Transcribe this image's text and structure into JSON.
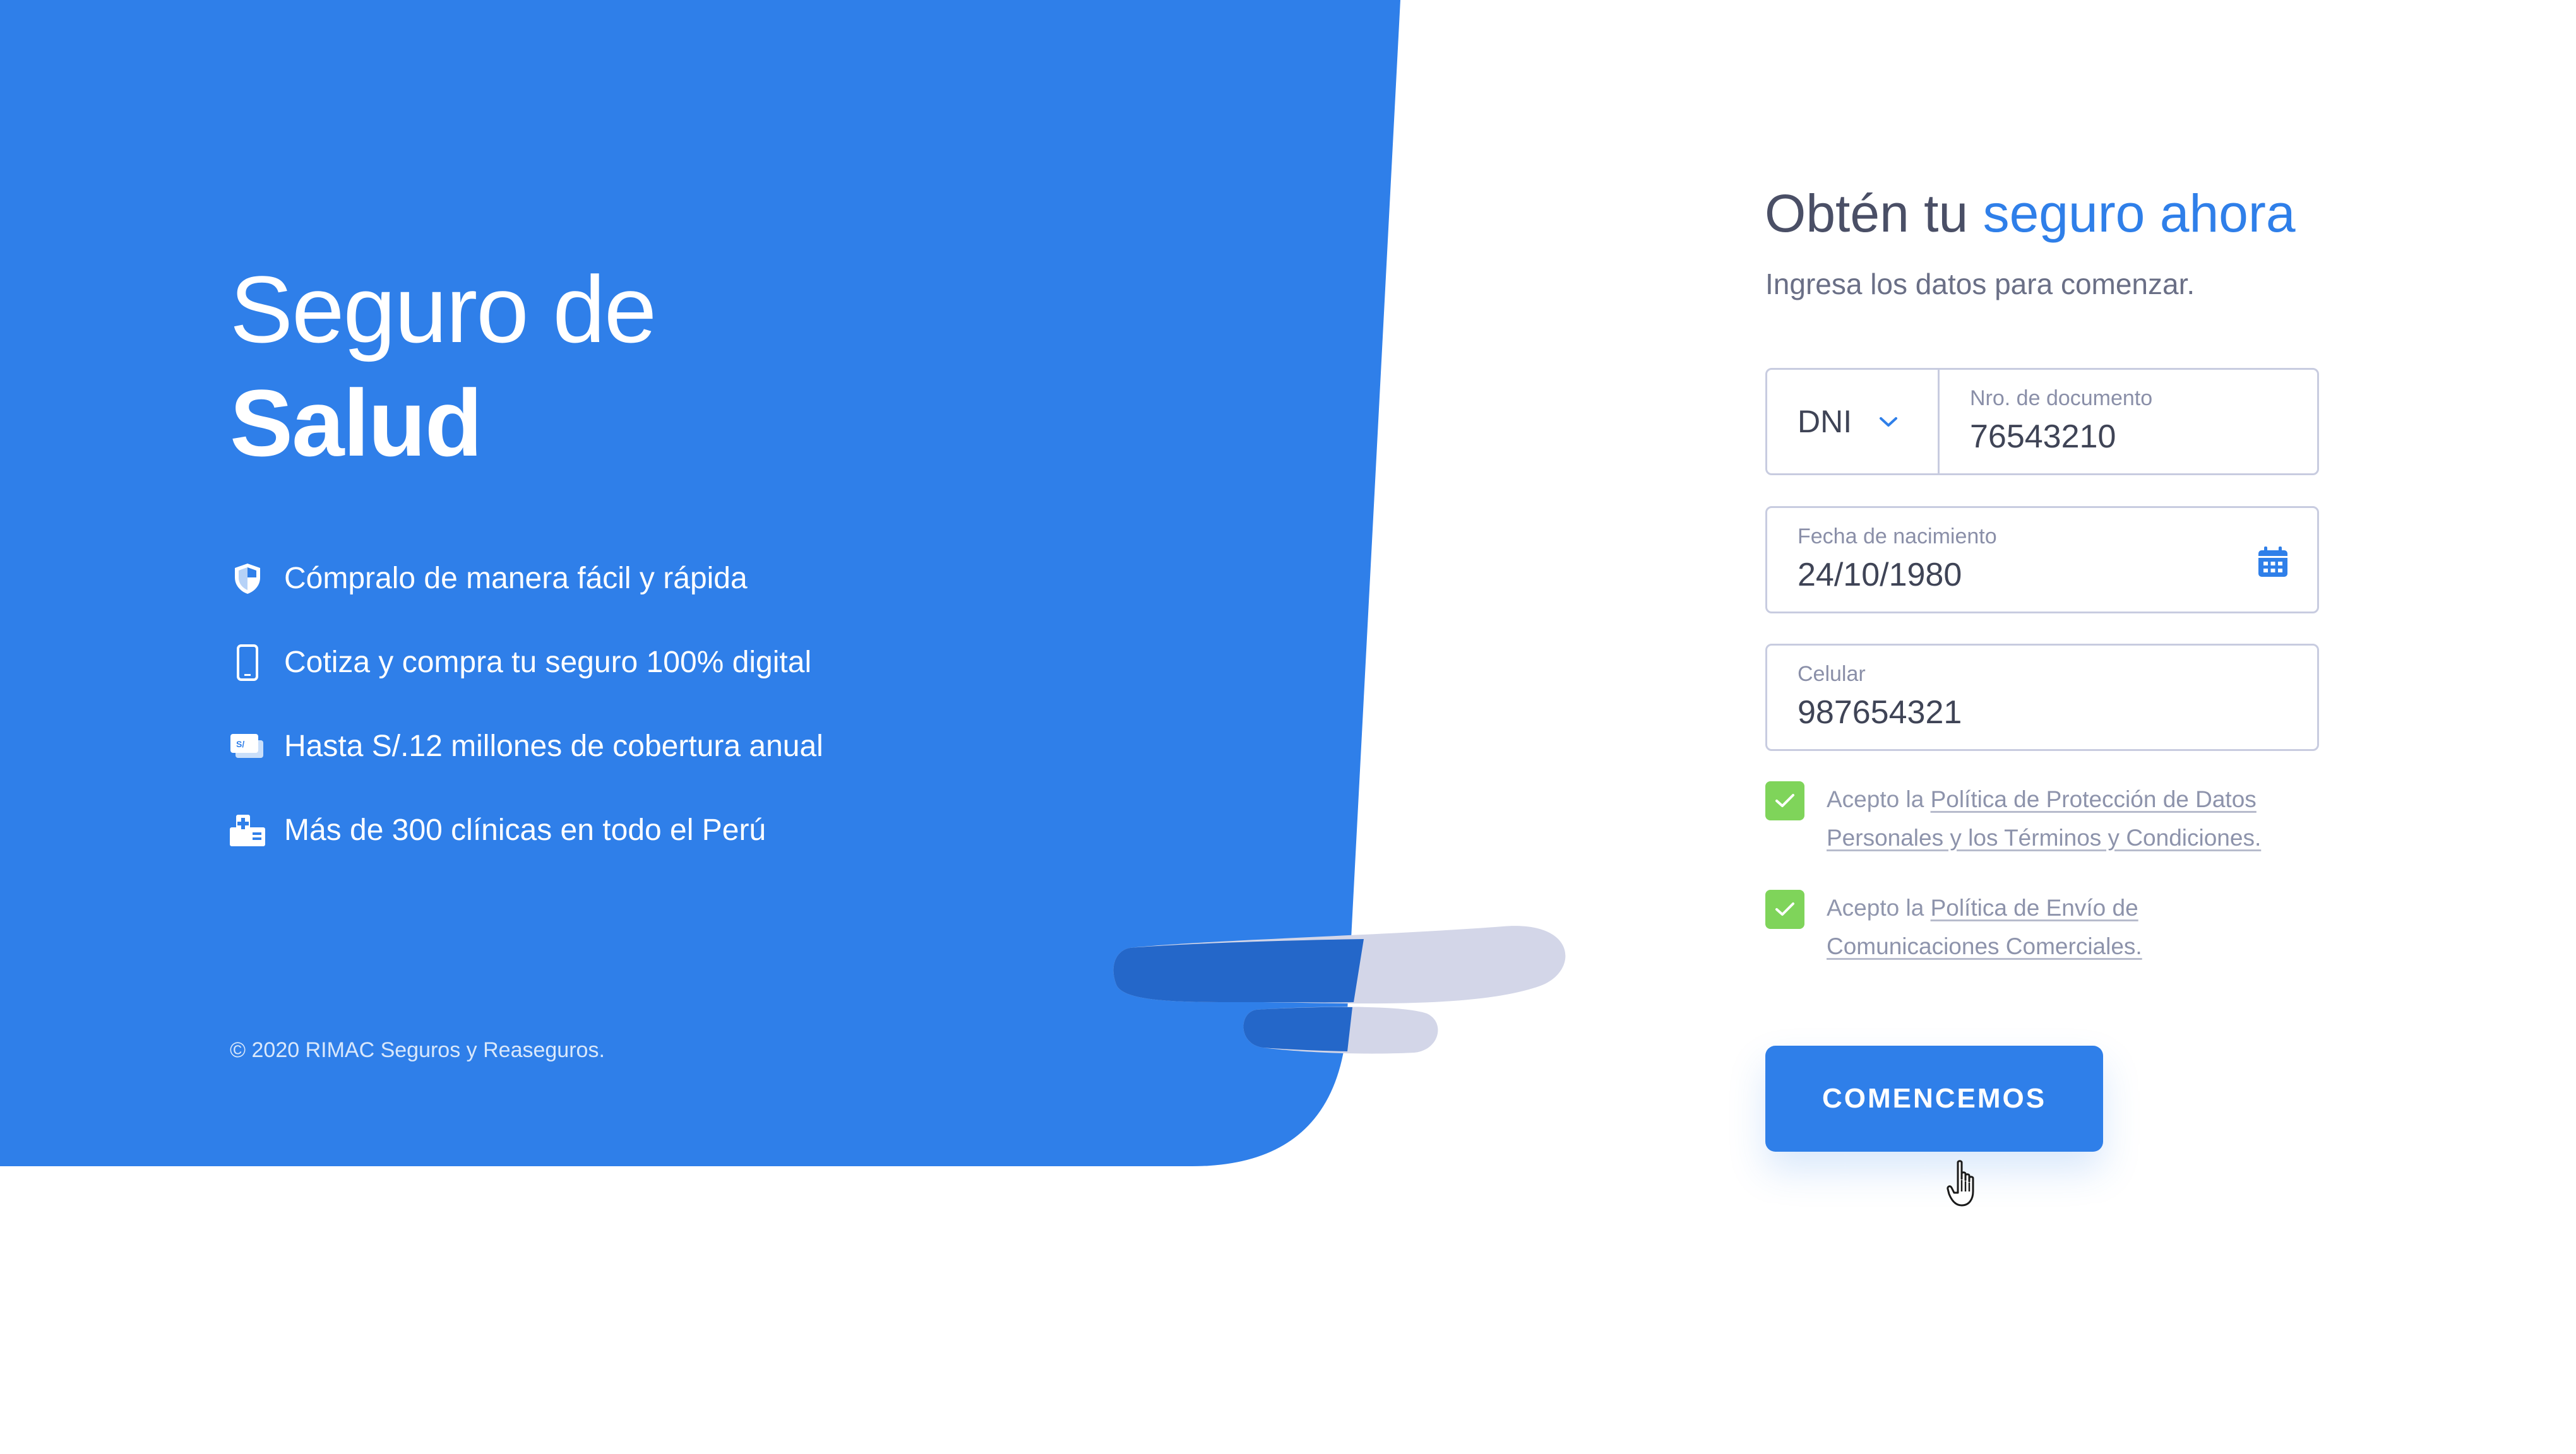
{
  "colors": {
    "brand_blue": "#2f7fe9",
    "check_green": "#7fd45a",
    "text_dark": "#4a4f66",
    "text_muted": "#8a8fa8"
  },
  "hero": {
    "title_line1": "Seguro de",
    "title_line2": "Salud",
    "features": [
      {
        "icon": "shield-icon",
        "text": "Cómpralo de manera fácil y rápida"
      },
      {
        "icon": "mobile-phone-icon",
        "text": "Cotiza y compra tu seguro 100% digital"
      },
      {
        "icon": "money-bills-icon",
        "text": "Hasta S/.12 millones de cobertura anual"
      },
      {
        "icon": "clinic-icon",
        "text": "Más de 300 clínicas en todo el Perú"
      }
    ],
    "money_icon_glyph": "S/",
    "copyright": "© 2020 RIMAC Seguros y Reaseguros."
  },
  "form": {
    "title_prefix": "Obtén tu ",
    "title_accent": "seguro ahora",
    "subtitle": "Ingresa los datos para comenzar.",
    "doc_type": {
      "value": "DNI"
    },
    "doc_number": {
      "label": "Nro. de documento",
      "value": "76543210"
    },
    "birth_date": {
      "label": "Fecha de nacimiento",
      "value": "24/10/1980"
    },
    "phone": {
      "label": "Celular",
      "value": "987654321"
    },
    "consents": [
      {
        "checked": true,
        "prefix": "Acepto la ",
        "link": "Política de Protección de Datos Personales y los Términos y Condiciones."
      },
      {
        "checked": true,
        "prefix": "Acepto la ",
        "link": "Política de Envío de Comunicaciones Comerciales."
      }
    ],
    "submit_label": "COMENCEMOS"
  }
}
